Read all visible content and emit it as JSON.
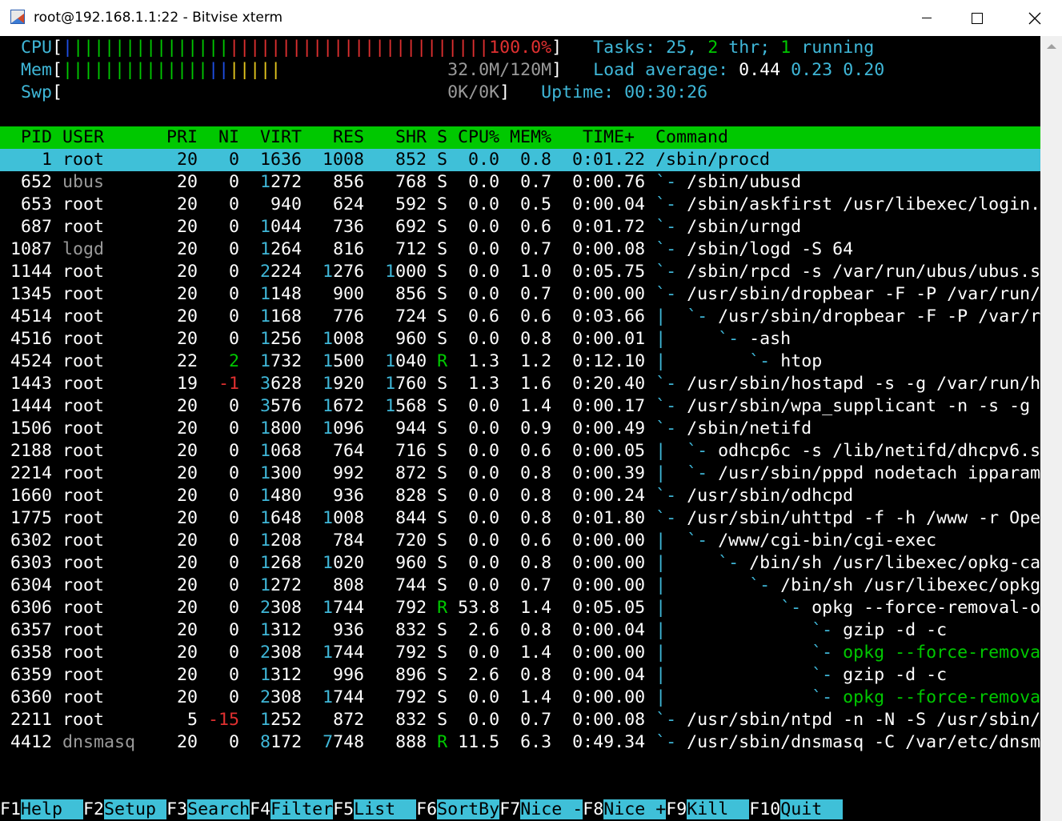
{
  "window": {
    "title": "root@192.168.1.1:22 - Bitvise xterm"
  },
  "palette": {
    "bg": "#000000",
    "fg": "#ffffff",
    "cyan": "#3fb7d8",
    "green": "#00c800",
    "red": "#e03030",
    "blue": "#1f4fe6",
    "yellow": "#e6c81e",
    "gray": "#9a9a9a",
    "header_bg": "#00c800",
    "selected_bg": "#3fc0d8",
    "fkey_bg": "#3fc0d8"
  },
  "terminal": {
    "lines": [
      {
        "row": 1,
        "segs": [
          [
            "  ",
            "fg"
          ],
          [
            "CPU",
            "cyan"
          ],
          [
            "[",
            "fg"
          ],
          [
            "|",
            "blue"
          ],
          [
            "|||||||||||||||",
            "green"
          ],
          [
            "|||||||||||||||||||||||||100.0%",
            "red"
          ],
          [
            "]",
            "fg"
          ],
          [
            "   ",
            "fg"
          ],
          [
            "Tasks: ",
            "cyan"
          ],
          [
            "25",
            "cyan"
          ],
          [
            ", ",
            "cyan"
          ],
          [
            "2",
            "green"
          ],
          [
            " thr; ",
            "cyan"
          ],
          [
            "1",
            "green"
          ],
          [
            " running",
            "cyan"
          ]
        ]
      },
      {
        "row": 2,
        "segs": [
          [
            "  ",
            "fg"
          ],
          [
            "Mem",
            "cyan"
          ],
          [
            "[",
            "fg"
          ],
          [
            "||||||||||||||",
            "green"
          ],
          [
            "||",
            "blue"
          ],
          [
            "|||||",
            "yellow"
          ],
          [
            "                32.0M/120M",
            "gray"
          ],
          [
            "]",
            "fg"
          ],
          [
            "   ",
            "fg"
          ],
          [
            "Load average: ",
            "cyan"
          ],
          [
            "0.44 ",
            "fg"
          ],
          [
            "0.23 ",
            "cyan"
          ],
          [
            "0.20",
            "cyan"
          ]
        ]
      },
      {
        "row": 3,
        "segs": [
          [
            "  ",
            "fg"
          ],
          [
            "Swp",
            "cyan"
          ],
          [
            "[",
            "fg"
          ],
          [
            "                                     0K/0K",
            "gray"
          ],
          [
            "]",
            "fg"
          ],
          [
            "   ",
            "fg"
          ],
          [
            "Uptime: ",
            "cyan"
          ],
          [
            "00:30:26",
            "cyan"
          ]
        ]
      },
      {
        "row": 5,
        "bg": "header_bg",
        "segs": [
          [
            "  PID ",
            "black"
          ],
          [
            "USER      ",
            "black"
          ],
          [
            "PRI  NI  VIRT   RES   SHR S CPU% MEM%   TIME+  Command",
            "black"
          ]
        ]
      },
      {
        "row": 6,
        "bg": "selected_bg",
        "segs": [
          [
            "    1 root       20   0  1636  1008   852 S  0.0  0.8  0:01.22 /sbin/procd",
            "black"
          ]
        ]
      },
      {
        "row": 7,
        "segs": [
          [
            "  652 ",
            "fg"
          ],
          [
            "ubus      ",
            "gray"
          ],
          [
            " 20   0  ",
            "fg"
          ],
          [
            "1",
            "cyan"
          ],
          [
            "272   856   768 S  0.0  0.7  0:00.76 ",
            "fg"
          ],
          [
            "`- ",
            "cyan"
          ],
          [
            "/sbin/ubusd",
            "fg"
          ]
        ]
      },
      {
        "row": 8,
        "segs": [
          [
            "  653 root       20   0   940   624   592 S  0.0  0.5  0:00.04 ",
            "fg"
          ],
          [
            "`- ",
            "cyan"
          ],
          [
            "/sbin/askfirst /usr/libexec/login.",
            "fg"
          ]
        ]
      },
      {
        "row": 9,
        "segs": [
          [
            "  687 root       20   0  ",
            "fg"
          ],
          [
            "1",
            "cyan"
          ],
          [
            "044   736   692 S  0.0  0.6  0:01.72 ",
            "fg"
          ],
          [
            "`- ",
            "cyan"
          ],
          [
            "/sbin/urngd",
            "fg"
          ]
        ]
      },
      {
        "row": 10,
        "segs": [
          [
            " 1087 ",
            "fg"
          ],
          [
            "logd      ",
            "gray"
          ],
          [
            " 20   0  ",
            "fg"
          ],
          [
            "1",
            "cyan"
          ],
          [
            "264   816   712 S  0.0  0.7  0:00.08 ",
            "fg"
          ],
          [
            "`- ",
            "cyan"
          ],
          [
            "/sbin/logd -S 64",
            "fg"
          ]
        ]
      },
      {
        "row": 11,
        "segs": [
          [
            " 1144 root       20   0  ",
            "fg"
          ],
          [
            "2",
            "cyan"
          ],
          [
            "224  ",
            "fg"
          ],
          [
            "1",
            "cyan"
          ],
          [
            "276  ",
            "fg"
          ],
          [
            "1",
            "cyan"
          ],
          [
            "000 S  0.0  1.0  0:05.75 ",
            "fg"
          ],
          [
            "`- ",
            "cyan"
          ],
          [
            "/sbin/rpcd -s /var/run/ubus/ubus.s",
            "fg"
          ]
        ]
      },
      {
        "row": 12,
        "segs": [
          [
            " 1345 root       20   0  ",
            "fg"
          ],
          [
            "1",
            "cyan"
          ],
          [
            "148   900   856 S  0.0  0.7  0:00.00 ",
            "fg"
          ],
          [
            "`- ",
            "cyan"
          ],
          [
            "/usr/sbin/dropbear -F -P /var/run/",
            "fg"
          ]
        ]
      },
      {
        "row": 13,
        "segs": [
          [
            " 4514 root       20   0  ",
            "fg"
          ],
          [
            "1",
            "cyan"
          ],
          [
            "168   776   724 S  0.6  0.6  0:03.66 ",
            "fg"
          ],
          [
            "|  `- ",
            "cyan"
          ],
          [
            "/usr/sbin/dropbear -F -P /var/r",
            "fg"
          ]
        ]
      },
      {
        "row": 14,
        "segs": [
          [
            " 4516 root       20   0  ",
            "fg"
          ],
          [
            "1",
            "cyan"
          ],
          [
            "256  ",
            "fg"
          ],
          [
            "1",
            "cyan"
          ],
          [
            "008   960 S  0.0  0.8  0:00.01 ",
            "fg"
          ],
          [
            "|     `- ",
            "cyan"
          ],
          [
            "-ash",
            "fg"
          ]
        ]
      },
      {
        "row": 15,
        "segs": [
          [
            " 4524 root       22   ",
            "fg"
          ],
          [
            "2",
            "green"
          ],
          [
            "  ",
            "fg"
          ],
          [
            "1",
            "cyan"
          ],
          [
            "732  ",
            "fg"
          ],
          [
            "1",
            "cyan"
          ],
          [
            "500  ",
            "fg"
          ],
          [
            "1",
            "cyan"
          ],
          [
            "040 ",
            "fg"
          ],
          [
            "R",
            "green"
          ],
          [
            "  1.3  1.2  0:12.10 ",
            "fg"
          ],
          [
            "|        `- ",
            "cyan"
          ],
          [
            "htop",
            "fg"
          ]
        ]
      },
      {
        "row": 16,
        "segs": [
          [
            " 1443 root       19  ",
            "fg"
          ],
          [
            "-1",
            "red"
          ],
          [
            "  ",
            "fg"
          ],
          [
            "3",
            "cyan"
          ],
          [
            "628  ",
            "fg"
          ],
          [
            "1",
            "cyan"
          ],
          [
            "920  ",
            "fg"
          ],
          [
            "1",
            "cyan"
          ],
          [
            "760 S  1.3  1.6  0:20.40 ",
            "fg"
          ],
          [
            "`- ",
            "cyan"
          ],
          [
            "/usr/sbin/hostapd -s -g /var/run/h",
            "fg"
          ]
        ]
      },
      {
        "row": 17,
        "segs": [
          [
            " 1444 root       20   0  ",
            "fg"
          ],
          [
            "3",
            "cyan"
          ],
          [
            "576  ",
            "fg"
          ],
          [
            "1",
            "cyan"
          ],
          [
            "672  ",
            "fg"
          ],
          [
            "1",
            "cyan"
          ],
          [
            "568 S  0.0  1.4  0:00.17 ",
            "fg"
          ],
          [
            "`- ",
            "cyan"
          ],
          [
            "/usr/sbin/wpa_supplicant -n -s -g ",
            "fg"
          ]
        ]
      },
      {
        "row": 18,
        "segs": [
          [
            " 1506 root       20   0  ",
            "fg"
          ],
          [
            "1",
            "cyan"
          ],
          [
            "800  ",
            "fg"
          ],
          [
            "1",
            "cyan"
          ],
          [
            "096   944 S  0.0  0.9  0:00.49 ",
            "fg"
          ],
          [
            "`- ",
            "cyan"
          ],
          [
            "/sbin/netifd",
            "fg"
          ]
        ]
      },
      {
        "row": 19,
        "segs": [
          [
            " 2188 root       20   0  ",
            "fg"
          ],
          [
            "1",
            "cyan"
          ],
          [
            "068   764   716 S  0.0  0.6  0:00.05 ",
            "fg"
          ],
          [
            "|  `- ",
            "cyan"
          ],
          [
            "odhcp6c -s /lib/netifd/dhcpv6.s",
            "fg"
          ]
        ]
      },
      {
        "row": 20,
        "segs": [
          [
            " 2214 root       20   0  ",
            "fg"
          ],
          [
            "1",
            "cyan"
          ],
          [
            "300   992   872 S  0.0  0.8  0:00.39 ",
            "fg"
          ],
          [
            "|  `- ",
            "cyan"
          ],
          [
            "/usr/sbin/pppd nodetach ipparam",
            "fg"
          ]
        ]
      },
      {
        "row": 21,
        "segs": [
          [
            " 1660 root       20   0  ",
            "fg"
          ],
          [
            "1",
            "cyan"
          ],
          [
            "480   936   828 S  0.0  0.8  0:00.24 ",
            "fg"
          ],
          [
            "`- ",
            "cyan"
          ],
          [
            "/usr/sbin/odhcpd",
            "fg"
          ]
        ]
      },
      {
        "row": 22,
        "segs": [
          [
            " 1775 root       20   0  ",
            "fg"
          ],
          [
            "1",
            "cyan"
          ],
          [
            "648  ",
            "fg"
          ],
          [
            "1",
            "cyan"
          ],
          [
            "008   844 S  0.0  0.8  0:01.80 ",
            "fg"
          ],
          [
            "`- ",
            "cyan"
          ],
          [
            "/usr/sbin/uhttpd -f -h /www -r Ope",
            "fg"
          ]
        ]
      },
      {
        "row": 23,
        "segs": [
          [
            " 6302 root       20   0  ",
            "fg"
          ],
          [
            "1",
            "cyan"
          ],
          [
            "208   784   720 S  0.0  0.6  0:00.00 ",
            "fg"
          ],
          [
            "|  `- ",
            "cyan"
          ],
          [
            "/www/cgi-bin/cgi-exec",
            "fg"
          ]
        ]
      },
      {
        "row": 24,
        "segs": [
          [
            " 6303 root       20   0  ",
            "fg"
          ],
          [
            "1",
            "cyan"
          ],
          [
            "268  ",
            "fg"
          ],
          [
            "1",
            "cyan"
          ],
          [
            "020   960 S  0.0  0.8  0:00.00 ",
            "fg"
          ],
          [
            "|     `- ",
            "cyan"
          ],
          [
            "/bin/sh /usr/libexec/opkg-ca",
            "fg"
          ]
        ]
      },
      {
        "row": 25,
        "segs": [
          [
            " 6304 root       20   0  ",
            "fg"
          ],
          [
            "1",
            "cyan"
          ],
          [
            "272   808   744 S  0.0  0.7  0:00.00 ",
            "fg"
          ],
          [
            "|        `- ",
            "cyan"
          ],
          [
            "/bin/sh /usr/libexec/opkg",
            "fg"
          ]
        ]
      },
      {
        "row": 26,
        "segs": [
          [
            " 6306 root       20   0  ",
            "fg"
          ],
          [
            "2",
            "cyan"
          ],
          [
            "308  ",
            "fg"
          ],
          [
            "1",
            "cyan"
          ],
          [
            "744   792 ",
            "fg"
          ],
          [
            "R",
            "green"
          ],
          [
            " 53.8  1.4  0:05.05 ",
            "fg"
          ],
          [
            "|           `- ",
            "cyan"
          ],
          [
            "opkg --force-removal-o",
            "fg"
          ]
        ]
      },
      {
        "row": 27,
        "segs": [
          [
            " 6357 root       20   0  ",
            "fg"
          ],
          [
            "1",
            "cyan"
          ],
          [
            "312   936   832 S  2.6  0.8  0:00.04 ",
            "fg"
          ],
          [
            "|              `- ",
            "cyan"
          ],
          [
            "gzip -d -c",
            "fg"
          ]
        ]
      },
      {
        "row": 28,
        "segs": [
          [
            " 6358 root       20   0  ",
            "fg"
          ],
          [
            "2",
            "cyan"
          ],
          [
            "308  ",
            "fg"
          ],
          [
            "1",
            "cyan"
          ],
          [
            "744   792 S  0.0  1.4  0:00.00 ",
            "fg"
          ],
          [
            "|              `- ",
            "cyan"
          ],
          [
            "opkg --force-remova",
            "green"
          ]
        ]
      },
      {
        "row": 29,
        "segs": [
          [
            " 6359 root       20   0  ",
            "fg"
          ],
          [
            "1",
            "cyan"
          ],
          [
            "312   996   896 S  2.6  0.8  0:00.04 ",
            "fg"
          ],
          [
            "|              `- ",
            "cyan"
          ],
          [
            "gzip -d -c",
            "fg"
          ]
        ]
      },
      {
        "row": 30,
        "segs": [
          [
            " 6360 root       20   0  ",
            "fg"
          ],
          [
            "2",
            "cyan"
          ],
          [
            "308  ",
            "fg"
          ],
          [
            "1",
            "cyan"
          ],
          [
            "744   792 S  0.0  1.4  0:00.00 ",
            "fg"
          ],
          [
            "|              `- ",
            "cyan"
          ],
          [
            "opkg --force-remova",
            "green"
          ]
        ]
      },
      {
        "row": 31,
        "segs": [
          [
            " 2211 root        5 ",
            "fg"
          ],
          [
            "-15",
            "red"
          ],
          [
            "  ",
            "fg"
          ],
          [
            "1",
            "cyan"
          ],
          [
            "252   872   832 S  0.0  0.7  0:00.08 ",
            "fg"
          ],
          [
            "`- ",
            "cyan"
          ],
          [
            "/usr/sbin/ntpd -n -N -S /usr/sbin/",
            "fg"
          ]
        ]
      },
      {
        "row": 32,
        "segs": [
          [
            " 4412 ",
            "fg"
          ],
          [
            "dnsmasq   ",
            "gray"
          ],
          [
            " 20   0  ",
            "fg"
          ],
          [
            "8",
            "cyan"
          ],
          [
            "172  ",
            "fg"
          ],
          [
            "7",
            "cyan"
          ],
          [
            "748   888 ",
            "fg"
          ],
          [
            "R",
            "green"
          ],
          [
            " 11.5  6.3  0:49.34 ",
            "fg"
          ],
          [
            "`- ",
            "cyan"
          ],
          [
            "/usr/sbin/dnsmasq -C /var/etc/dnsm",
            "fg"
          ]
        ]
      }
    ]
  },
  "fkeys": [
    {
      "key": "F1",
      "label": "Help  "
    },
    {
      "key": "F2",
      "label": "Setup "
    },
    {
      "key": "F3",
      "label": "Search"
    },
    {
      "key": "F4",
      "label": "Filter"
    },
    {
      "key": "F5",
      "label": "List  "
    },
    {
      "key": "F6",
      "label": "SortBy"
    },
    {
      "key": "F7",
      "label": "Nice -"
    },
    {
      "key": "F8",
      "label": "Nice +"
    },
    {
      "key": "F9",
      "label": "Kill  "
    },
    {
      "key": "F10",
      "label": "Quit  "
    }
  ]
}
